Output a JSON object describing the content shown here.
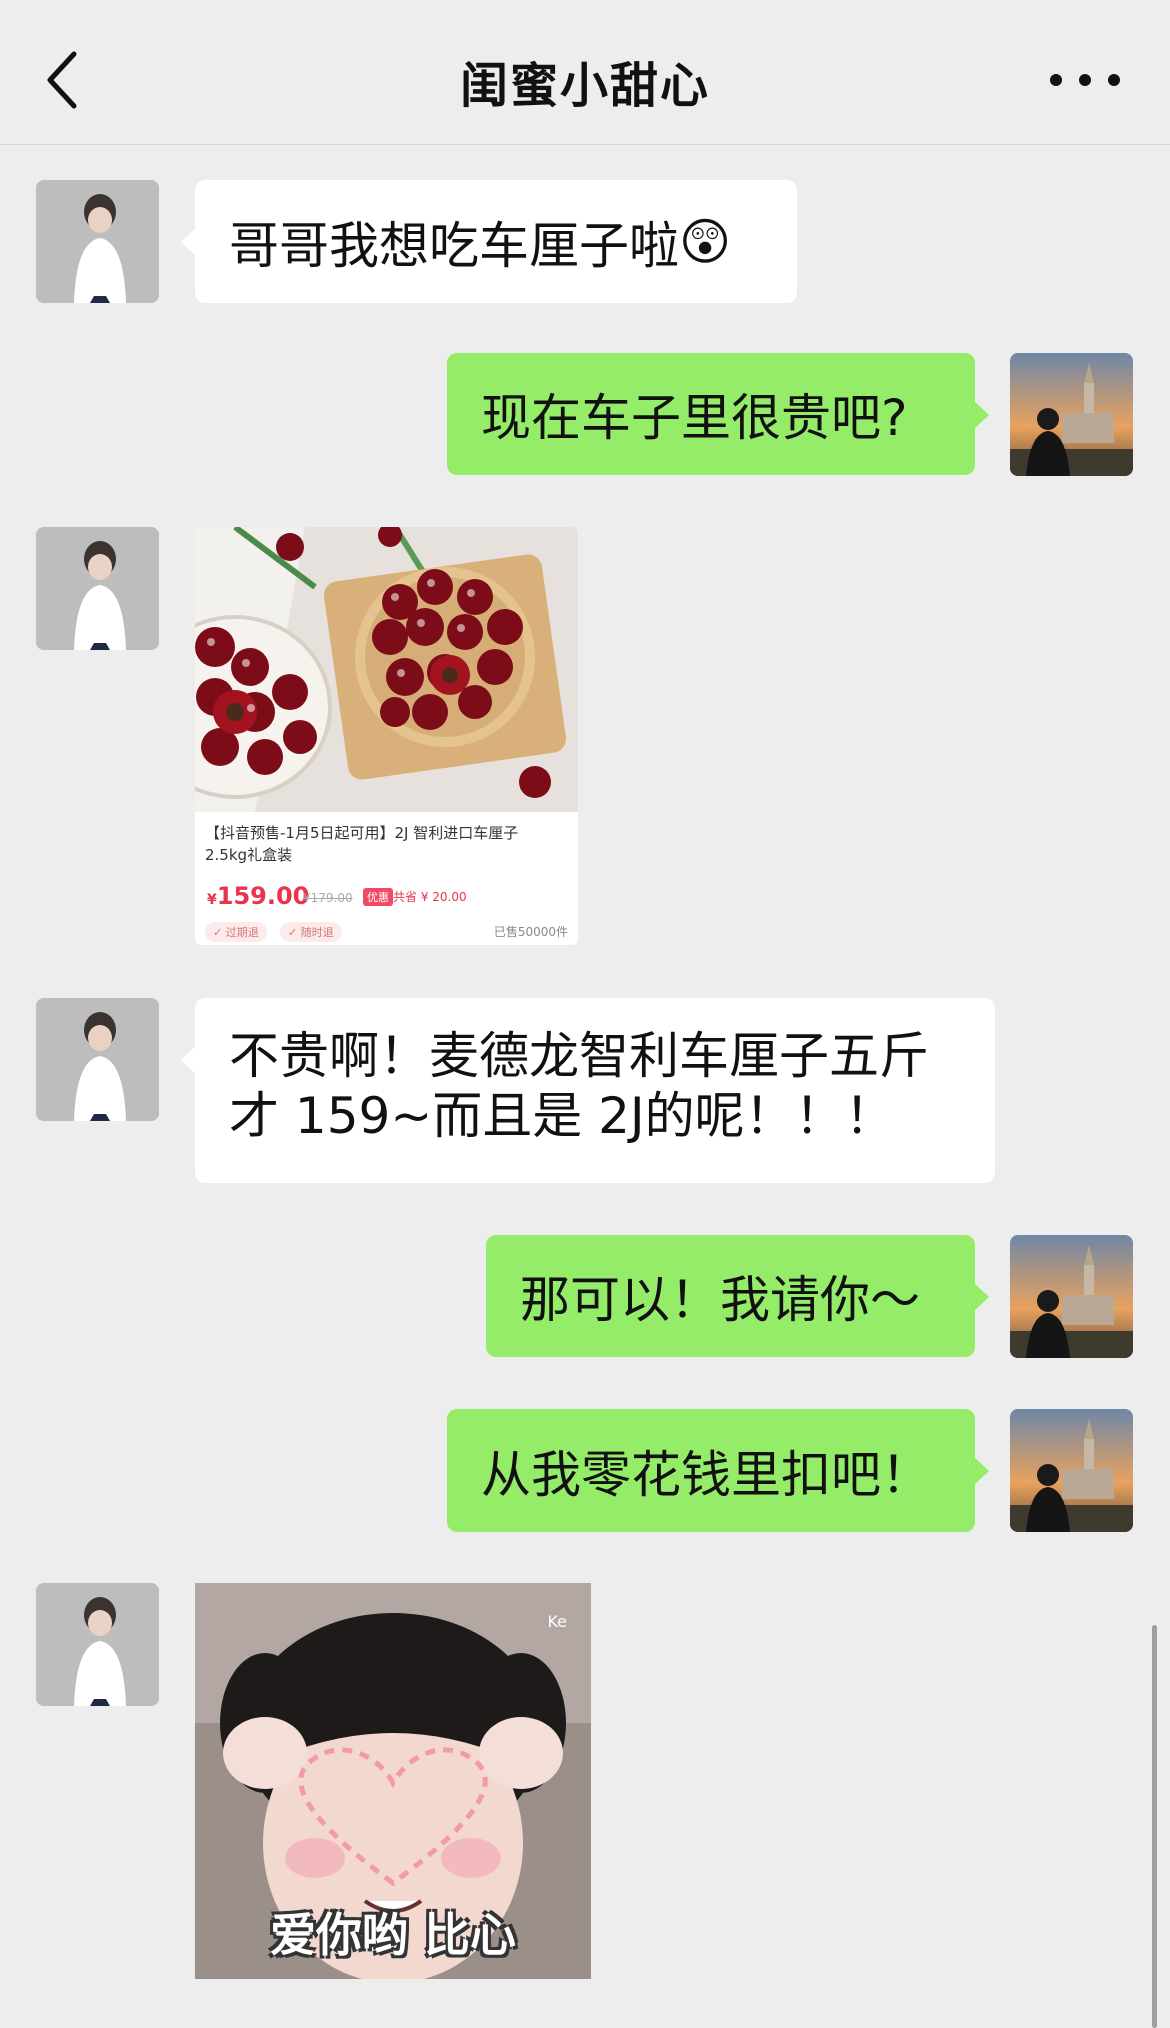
{
  "header": {
    "title": "闺蜜小甜心"
  },
  "messages": [
    {
      "side": "left",
      "type": "text",
      "text": "哥哥我想吃车厘子啦",
      "emoji": "😲"
    },
    {
      "side": "right",
      "type": "text",
      "text": "现在车子里很贵吧?"
    },
    {
      "side": "left",
      "type": "product",
      "title": "【抖音预售-1月5日起可用】2J 智利进口车厘子 2.5kg礼盒装",
      "currency": "¥",
      "price": "159.00",
      "original_price": "¥179.00",
      "deal_tag": "优惠",
      "saving": "共省 ¥ 20.00",
      "tags": [
        "过期退",
        "随时退"
      ],
      "sold": "已售50000件"
    },
    {
      "side": "left",
      "type": "text",
      "lines": [
        "不贵啊！麦德龙智利车厘子五斤",
        "才 159~而且是 2J的呢！！！"
      ]
    },
    {
      "side": "right",
      "type": "text",
      "text": "那可以！我请你～"
    },
    {
      "side": "right",
      "type": "text",
      "text": "从我零花钱里扣吧！"
    },
    {
      "side": "left",
      "type": "sticker",
      "caption": "爱你哟 比心",
      "watermark": "Ke"
    }
  ],
  "icons": {
    "back": "chevron-left-icon",
    "more": "more-dots-icon"
  },
  "colors": {
    "background": "#ededed",
    "left_bubble": "#ffffff",
    "right_bubble": "#95ec69",
    "price": "#e8344e"
  }
}
